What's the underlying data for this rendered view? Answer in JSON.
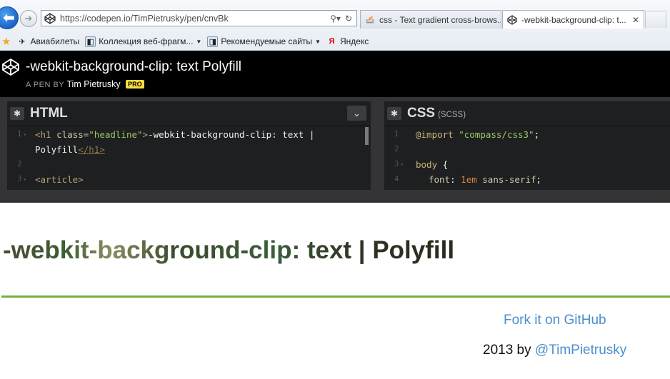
{
  "browser": {
    "url": "https://codepen.io/TimPietrusky/pen/cnvBk",
    "tabs": [
      {
        "label": "css - Text gradient cross-brows..."
      },
      {
        "label": "-webkit-background-clip: t...",
        "close": "✕"
      }
    ],
    "favorites": [
      {
        "label": "Авиабилеты"
      },
      {
        "label": "Коллекция веб-фрагм..."
      },
      {
        "label": "Рекомендуемые сайты"
      },
      {
        "label": "Яндекс"
      }
    ]
  },
  "pen": {
    "title": "-webkit-background-clip: text Polyfill",
    "by_prefix": "A PEN BY",
    "author": "Tim Pietrusky",
    "badge": "PRO"
  },
  "editors": {
    "html": {
      "title": "HTML",
      "lines": [
        {
          "num": "1",
          "open": "<h1 ",
          "attr": "class=",
          "str": "\"headline\"",
          "close": ">",
          "text": "-webkit-background-clip: text |"
        },
        {
          "num": "",
          "text": "Polyfill",
          "endtag": "</h1>"
        },
        {
          "num": "2",
          "text": ""
        },
        {
          "num": "3",
          "tag": "<article>"
        }
      ]
    },
    "css": {
      "title": "CSS",
      "subtitle": "(SCSS)",
      "lines": [
        {
          "num": "1",
          "kw": "@import",
          "str": "\"compass/css3\"",
          "end": ";"
        },
        {
          "num": "2",
          "text": ""
        },
        {
          "num": "3",
          "sel": "body",
          "brace": " {"
        },
        {
          "num": "4",
          "prop": "font",
          "colon": ": ",
          "num_val": "1em",
          "val": " sans-serif",
          "end": ";"
        }
      ]
    }
  },
  "preview": {
    "headline": "-webkit-background-clip: text | Polyfill",
    "fork_link": "Fork it on GitHub",
    "credit_prefix": "2013 by ",
    "credit_handle": "@TimPietrusky"
  },
  "colors": {
    "accent_green": "#75b03c",
    "link_blue": "#4a8fce",
    "codepen_black": "#000000",
    "editor_bg": "#1d1f20",
    "pro_yellow": "#ffdd40"
  }
}
